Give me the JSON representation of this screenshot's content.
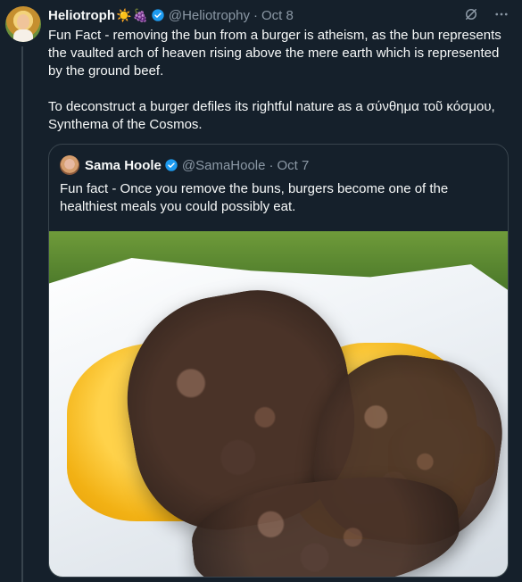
{
  "post": {
    "author_name": "Heliotroph",
    "author_emojis": [
      "sun-emoji",
      "grapes-emoji"
    ],
    "handle": "@Heliotrophy",
    "separator": "·",
    "date": "Oct 8",
    "text": "Fun Fact - removing the bun from a burger is atheism, as the bun represents the vaulted arch of heaven rising above the mere earth which is represented by the ground beef.\n\nTo deconstruct a burger defiles its rightful nature as a σύνθημα τοῦ κόσμου, Synthema of the Cosmos.",
    "icons": [
      "grok-icon",
      "more-icon"
    ]
  },
  "quoted": {
    "author_name": "Sama Hoole",
    "handle": "@SamaHoole",
    "separator": "·",
    "date": "Oct 7",
    "text": "Fun fact - Once you remove the buns, burgers become one of the healthiest meals you could possibly eat.",
    "image": "cheeseburger-patties-photo"
  },
  "colors": {
    "background": "#15202b",
    "text": "#f7f9f9",
    "muted": "#8b98a5",
    "border": "#38444d",
    "verified": "#1d9bf0"
  }
}
